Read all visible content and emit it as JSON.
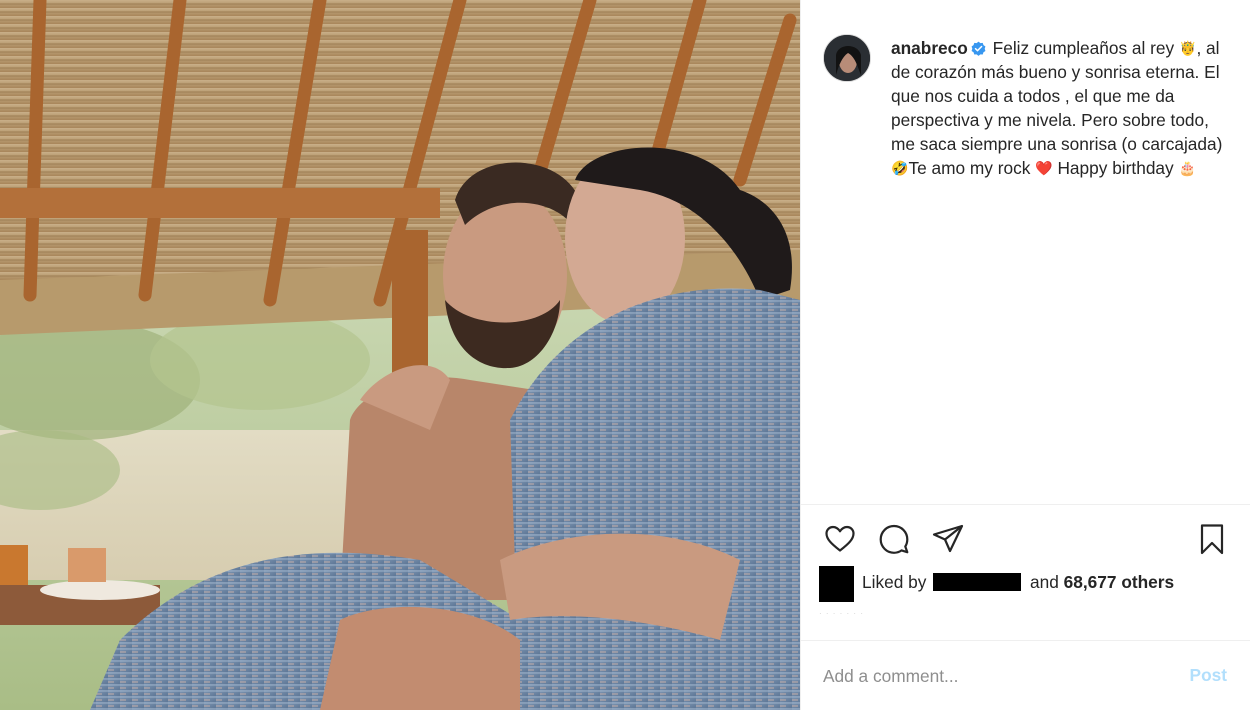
{
  "post": {
    "username": "anabreco",
    "verified": true,
    "caption_parts": {
      "p1": "Feliz cumpleaños al rey ",
      "emoji_crown": "🤴",
      "p2": ", al de corazón más bueno y sonrisa eterna. El que nos cuida a todos , el que me da perspectiva y me nivela. Pero sobre todo, me saca siempre una sonrisa (o carcajada) ",
      "emoji_laugh": "🤣",
      "p3": "Te amo my rock ",
      "emoji_heart": "❤️",
      "p4": " Happy birthday ",
      "emoji_cake": "🎂"
    }
  },
  "likes": {
    "prefix": "Liked by",
    "and": "and",
    "count": "68,677 others"
  },
  "comment": {
    "placeholder": "Add a comment...",
    "post_label": "Post"
  },
  "icons": {
    "like": "heart-outline-icon",
    "comment": "speech-bubble-icon",
    "share": "paper-plane-icon",
    "save": "bookmark-icon",
    "verified": "verified-badge-icon"
  },
  "colors": {
    "verified_blue": "#3897f0",
    "post_disabled": "#b2dffc",
    "placeholder_grey": "#8e8e8e",
    "text": "#262626"
  }
}
